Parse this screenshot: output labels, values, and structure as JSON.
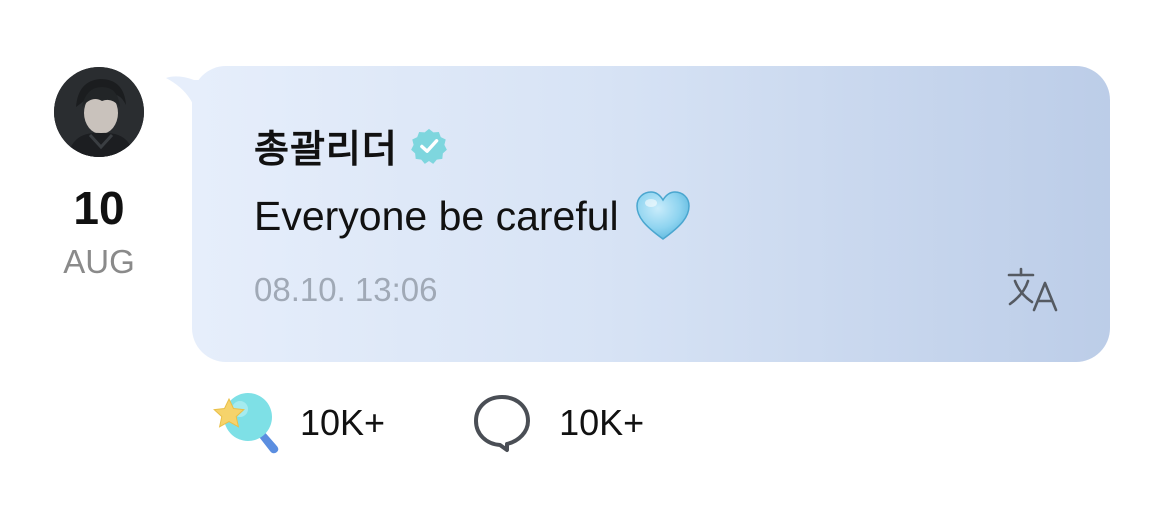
{
  "post": {
    "date_day": "10",
    "date_month": "AUG",
    "author": "총괄리더",
    "message": "Everyone be careful",
    "timestamp": "08.10. 13:06"
  },
  "reactions": {
    "likes": "10K+",
    "comments": "10K+"
  },
  "colors": {
    "bubble_start": "#e6eefb",
    "bubble_end": "#bccde8",
    "verified_badge": "#7ed6de",
    "timestamp": "#a0a9b6",
    "heart": "#8fd4f0"
  },
  "icons": {
    "verified": "verified-badge-icon",
    "heart": "light-blue-heart-emoji",
    "translate": "translate-icon",
    "likes": "lightstick-star-icon",
    "comments": "speech-bubble-icon"
  }
}
